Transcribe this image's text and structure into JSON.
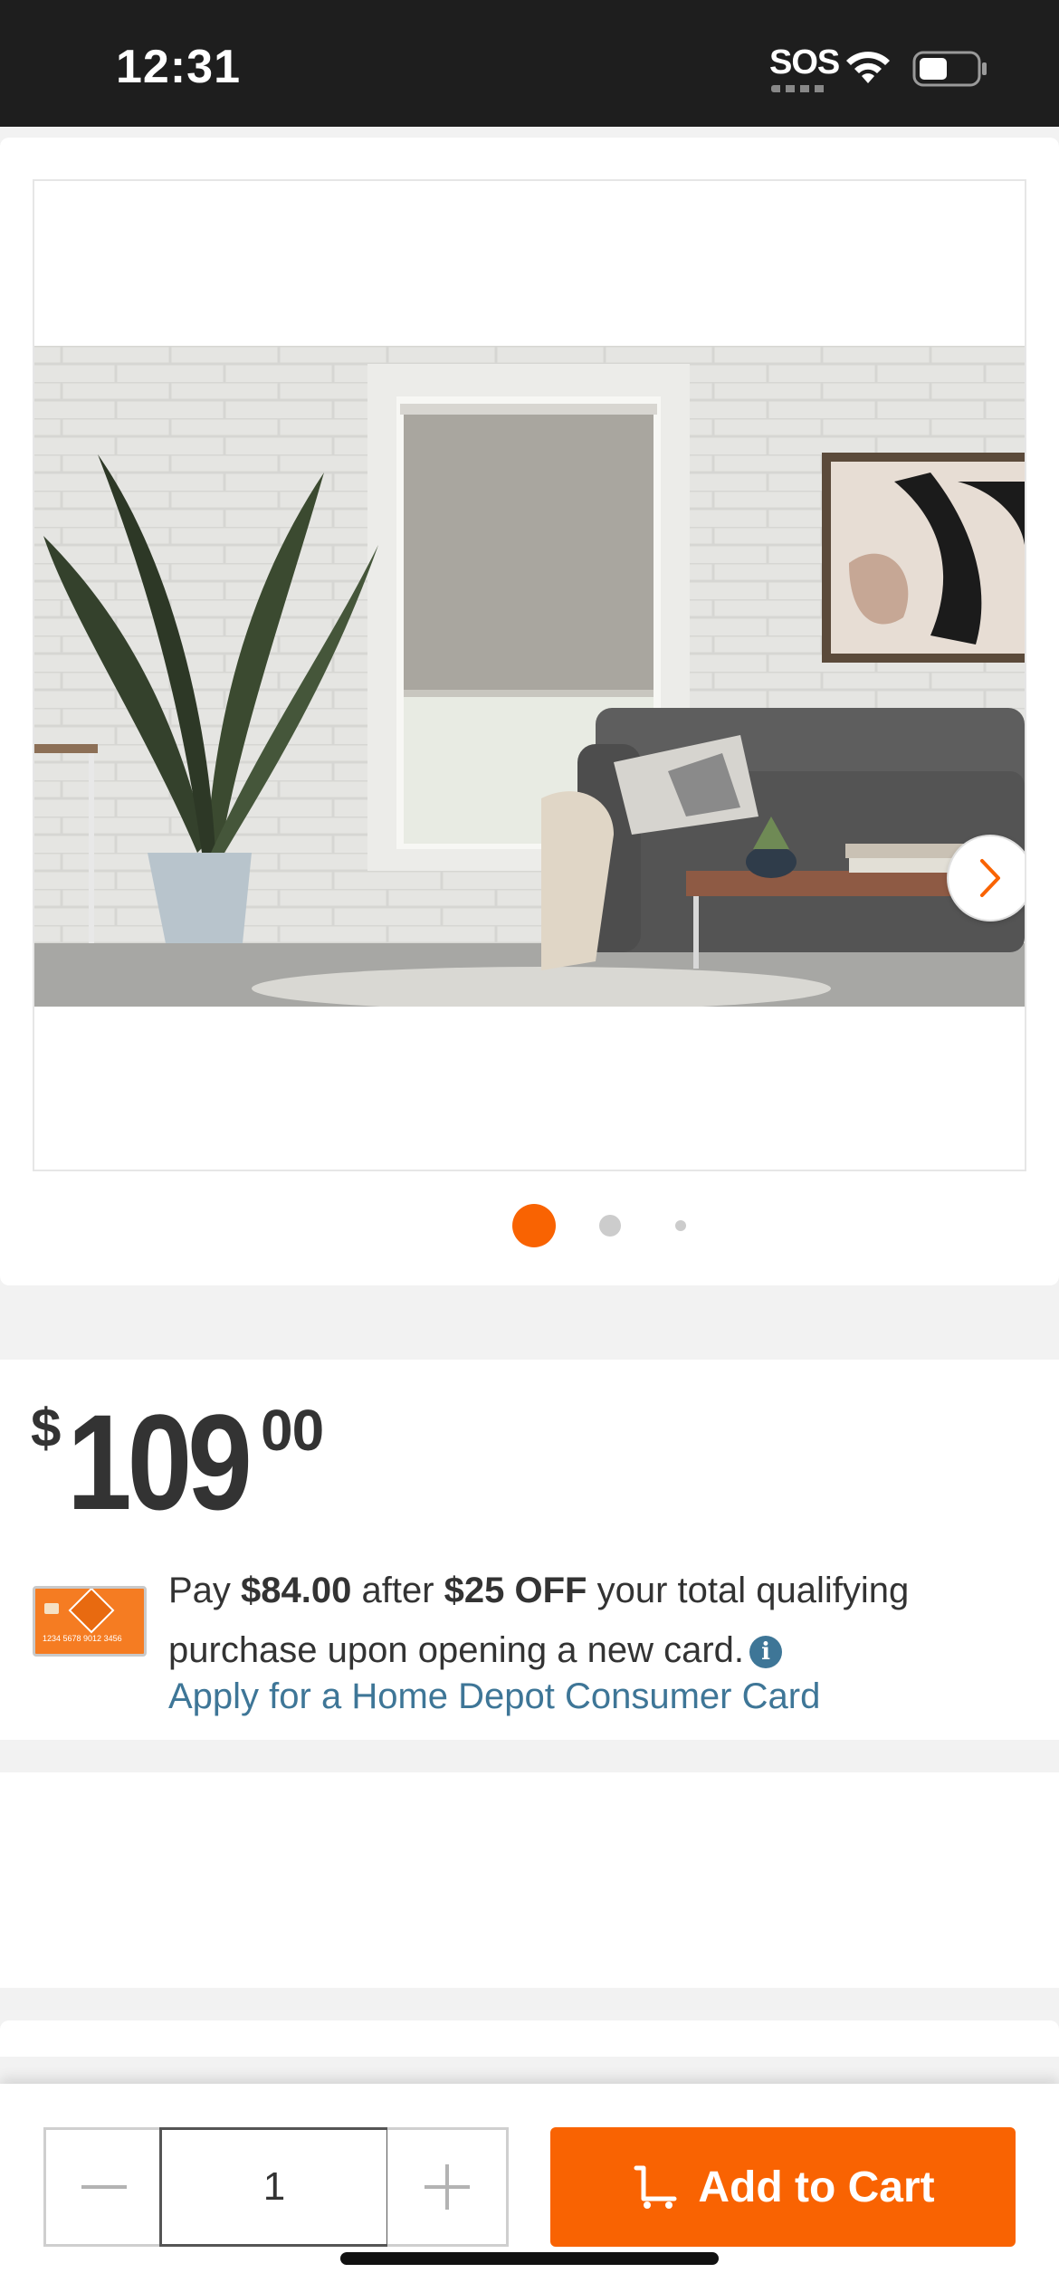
{
  "status_bar": {
    "time": "12:31",
    "sos": "SOS",
    "wifi_icon": "wifi-icon",
    "battery_icon": "battery-icon"
  },
  "gallery": {
    "image": "living-room-roller-shade-photo",
    "next_icon": "chevron-right-icon",
    "page_count": 3,
    "active_page": 1
  },
  "price": {
    "currency": "$",
    "whole": "109",
    "cents": "00"
  },
  "card_promo": {
    "card_image": "home-depot-credit-card-image",
    "text_pay": "Pay ",
    "amount_after": "$84.00",
    "text_after": " after ",
    "discount": "$25 OFF",
    "text_rest": " your total qualifying purchase upon opening a new card.",
    "info_icon": "info-icon",
    "info_glyph": "i",
    "apply_link": "Apply for a Home Depot Consumer Card"
  },
  "cart_bar": {
    "quantity": "1",
    "minus_icon": "minus-icon",
    "plus_icon": "plus-icon",
    "cart_icon": "cart-icon",
    "add_to_cart_label": "Add to Cart"
  },
  "colors": {
    "brand_orange": "#f96302",
    "link_blue": "#3e7697",
    "text_dark": "#333333",
    "status_bar_bg": "#1e1e1e"
  }
}
